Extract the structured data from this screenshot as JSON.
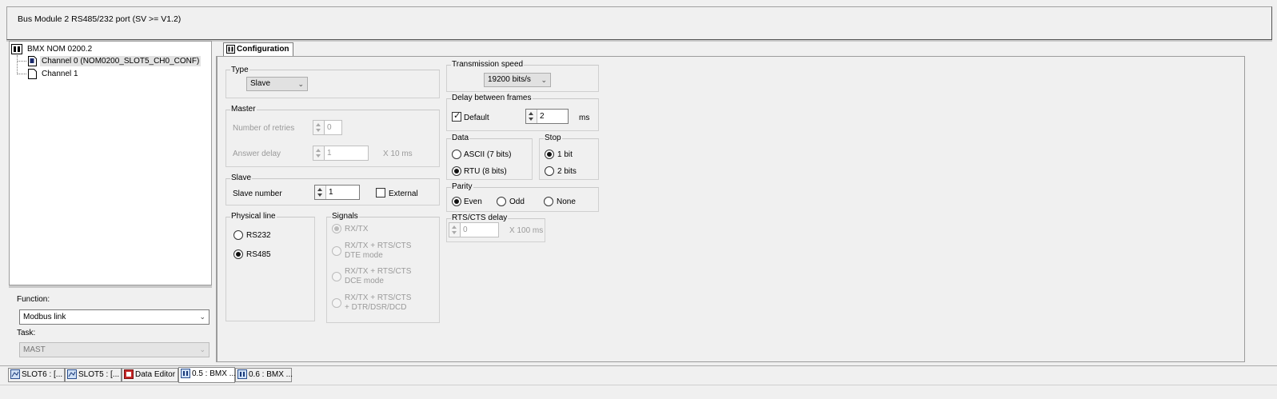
{
  "header": {
    "title": "Bus Module 2 RS485/232 port (SV >= V1.2)"
  },
  "tree": {
    "root": "BMX NOM 0200.2",
    "items": [
      {
        "label": "Channel 0 (NOM0200_SLOT5_CH0_CONF)",
        "selected": true
      },
      {
        "label": "Channel 1",
        "selected": false
      }
    ]
  },
  "lower": {
    "function_label": "Function:",
    "function_value": "Modbus link",
    "task_label": "Task:",
    "task_value": "MAST"
  },
  "tab": {
    "label": "Configuration"
  },
  "type_group": {
    "title": "Type",
    "value": "Slave"
  },
  "master_group": {
    "title": "Master",
    "retries_label": "Number of retries",
    "retries_value": "0",
    "answer_label": "Answer delay",
    "answer_value": "1",
    "answer_unit": "X 10 ms"
  },
  "slave_group": {
    "title": "Slave",
    "number_label": "Slave number",
    "number_value": "1",
    "external_label": "External"
  },
  "physical_group": {
    "title": "Physical line",
    "options": [
      "RS232",
      "RS485"
    ],
    "selected": "RS485"
  },
  "signals_group": {
    "title": "Signals",
    "opt1": "RX/TX",
    "opt2_line1": "RX/TX + RTS/CTS",
    "opt2_line2": "DTE mode",
    "opt3_line1": "RX/TX + RTS/CTS",
    "opt3_line2": "DCE mode",
    "opt4_line1": "RX/TX + RTS/CTS",
    "opt4_line2": "+ DTR/DSR/DCD"
  },
  "speed_group": {
    "title": "Transmission speed",
    "value": "19200 bits/s"
  },
  "delay_group": {
    "title": "Delay between frames",
    "default_label": "Default",
    "value": "2",
    "unit": "ms"
  },
  "data_group": {
    "title": "Data",
    "options": [
      "ASCII (7 bits)",
      "RTU (8 bits)"
    ],
    "selected": "RTU (8 bits)"
  },
  "stop_group": {
    "title": "Stop",
    "options": [
      "1 bit",
      "2 bits"
    ],
    "selected": "1 bit"
  },
  "parity_group": {
    "title": "Parity",
    "options": [
      "Even",
      "Odd",
      "None"
    ],
    "selected": "Even"
  },
  "rts_group": {
    "title": "RTS/CTS delay",
    "value": "0",
    "unit": "X 100 ms"
  },
  "bottom_tabs": [
    {
      "label": "SLOT6 : [...",
      "active": false
    },
    {
      "label": "SLOT5 : [...",
      "active": false
    },
    {
      "label": "Data Editor",
      "active": false
    },
    {
      "label": "0.5 : BMX ...",
      "active": true
    },
    {
      "label": "0.6 : BMX ...",
      "active": false
    }
  ]
}
